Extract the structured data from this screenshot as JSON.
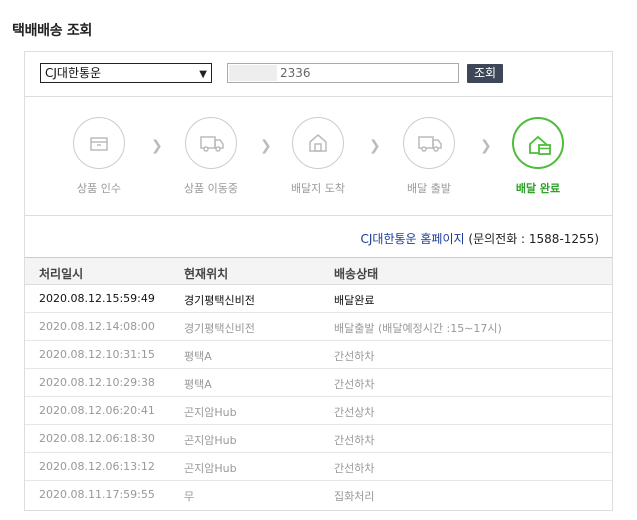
{
  "page_title": "택배배송 조회",
  "search": {
    "carrier": "CJ대한통운",
    "tracking_value": "2336",
    "button_label": "조회"
  },
  "steps": [
    {
      "label": "상품 인수",
      "icon": "box-icon",
      "active": false
    },
    {
      "label": "상품 이동중",
      "icon": "truck-icon",
      "active": false
    },
    {
      "label": "배달지 도착",
      "icon": "house-icon",
      "active": false
    },
    {
      "label": "배달 출발",
      "icon": "delivery-truck-icon",
      "active": false
    },
    {
      "label": "배달 완료",
      "icon": "delivered-house-icon",
      "active": true
    }
  ],
  "colors": {
    "active": "#4cbc3a",
    "inactive": "#cccccc",
    "button": "#3e4757",
    "link": "#1a3a9b"
  },
  "homepage": {
    "link_text": "CJ대한통운 홈페이지",
    "contact_text": "(문의전화 : 1588-1255)"
  },
  "table": {
    "headers": {
      "time": "처리일시",
      "location": "현재위치",
      "status": "배송상태"
    },
    "rows": [
      {
        "time": "2020.08.12.15:59:49",
        "location": "경기평택신비전",
        "status": "배달완료"
      },
      {
        "time": "2020.08.12.14:08:00",
        "location": "경기평택신비전",
        "status": "배달출발 (배달예정시간 :15∼17시)"
      },
      {
        "time": "2020.08.12.10:31:15",
        "location": "평택A",
        "status": "간선하차"
      },
      {
        "time": "2020.08.12.10:29:38",
        "location": "평택A",
        "status": "간선하차"
      },
      {
        "time": "2020.08.12.06:20:41",
        "location": "곤지암Hub",
        "status": "간선상차"
      },
      {
        "time": "2020.08.12.06:18:30",
        "location": "곤지암Hub",
        "status": "간선하차"
      },
      {
        "time": "2020.08.12.06:13:12",
        "location": "곤지암Hub",
        "status": "간선하차"
      },
      {
        "time": "2020.08.11.17:59:55",
        "location": "무",
        "status": "집화처리"
      }
    ]
  }
}
